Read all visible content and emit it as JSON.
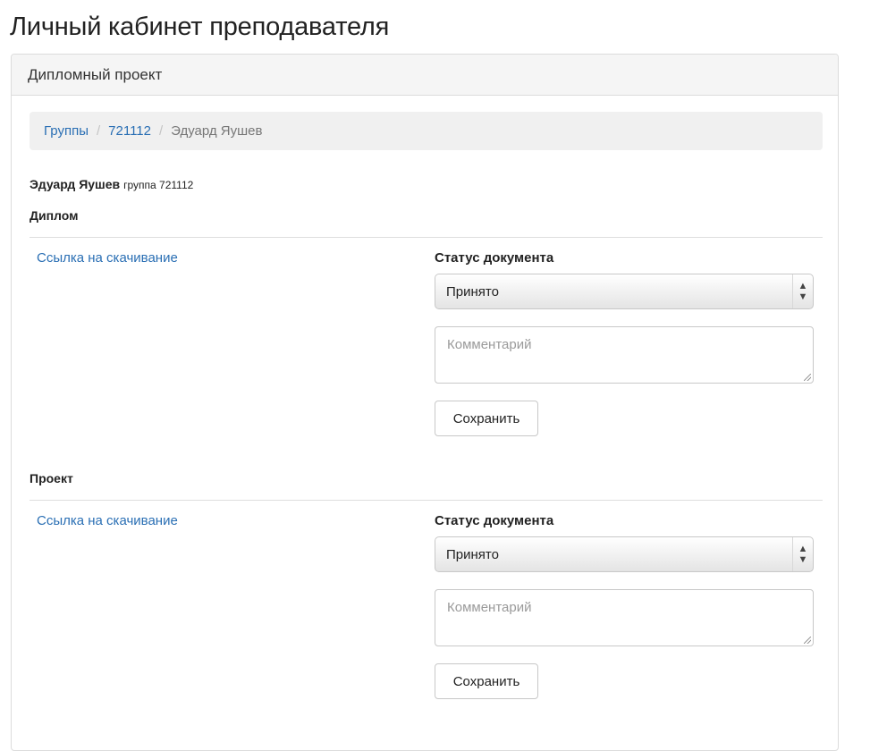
{
  "page": {
    "title": "Личный кабинет преподавателя"
  },
  "panel": {
    "heading": "Дипломный проект"
  },
  "breadcrumb": {
    "items": [
      "Группы",
      "721112",
      "Эдуард Яушев"
    ],
    "separator": "/"
  },
  "student": {
    "name": "Эдуард Яушев",
    "group": "группа 721112"
  },
  "sections": [
    {
      "title": "Диплом",
      "download_link": "Ссылка на скачивание",
      "status_label": "Статус документа",
      "status_value": "Принято",
      "comment_placeholder": "Комментарий",
      "save_label": "Сохранить"
    },
    {
      "title": "Проект",
      "download_link": "Ссылка на скачивание",
      "status_label": "Статус документа",
      "status_value": "Принято",
      "comment_placeholder": "Комментарий",
      "save_label": "Сохранить"
    }
  ],
  "icons": {
    "select_arrows": "updown-arrows-icon",
    "resize_grip": "resize-grip-icon"
  },
  "colors": {
    "link": "#2a6fb4",
    "panel_heading_bg": "#f5f5f5",
    "breadcrumb_bg": "#f0f0f0"
  }
}
